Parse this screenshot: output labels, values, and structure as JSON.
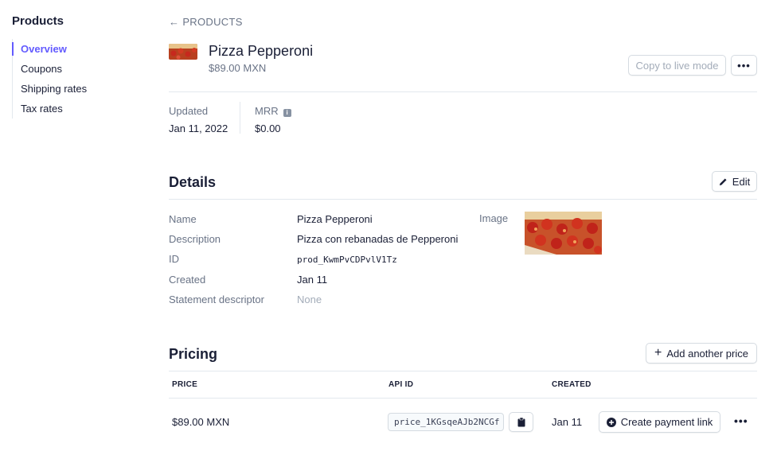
{
  "sidebar": {
    "title": "Products",
    "items": [
      {
        "label": "Overview"
      },
      {
        "label": "Coupons"
      },
      {
        "label": "Shipping rates"
      },
      {
        "label": "Tax rates"
      }
    ]
  },
  "header": {
    "back_link": "PRODUCTS",
    "product_name": "Pizza Pepperoni",
    "product_price": "$89.00 MXN",
    "copy_button": "Copy to live mode",
    "more_button": "•••"
  },
  "stats": {
    "updated_label": "Updated",
    "updated_value": "Jan 11, 2022",
    "mrr_label": "MRR",
    "mrr_value": "$0.00"
  },
  "details": {
    "title": "Details",
    "edit_button": "Edit",
    "rows": [
      {
        "label": "Name",
        "value": "Pizza Pepperoni"
      },
      {
        "label": "Description",
        "value": "Pizza con rebanadas de Pepperoni"
      },
      {
        "label": "ID",
        "value": "prod_KwmPvCDPvlV1Tz"
      },
      {
        "label": "Created",
        "value": "Jan 11"
      },
      {
        "label": "Statement descriptor",
        "value": "None"
      }
    ],
    "image_label": "Image"
  },
  "pricing": {
    "title": "Pricing",
    "add_button": "Add another price",
    "columns": [
      "PRICE",
      "API ID",
      "CREATED"
    ],
    "rows": [
      {
        "price": "$89.00 MXN",
        "api_id": "price_1KGsqeAJb2NCGf",
        "created": "Jan 11",
        "action": "Create payment link",
        "more": "•••"
      }
    ]
  },
  "colors": {
    "accent": "#635bff",
    "text": "#1a1f36",
    "muted": "#697386",
    "border": "#e3e8ee"
  }
}
